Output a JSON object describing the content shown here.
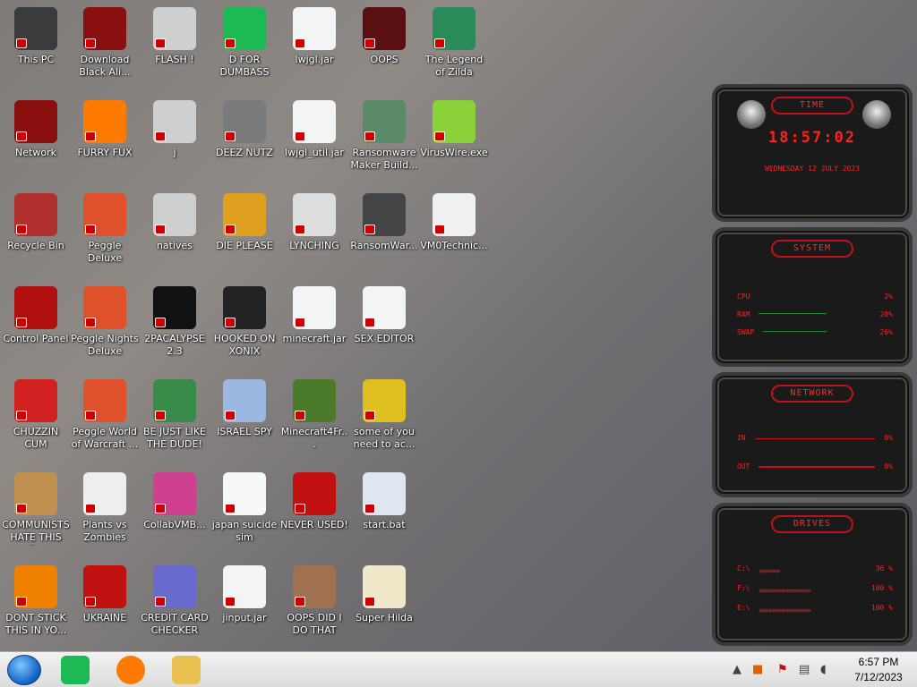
{
  "desktop": {
    "icons": [
      {
        "label": "This PC",
        "icon": "computer-icon",
        "color": "#3b3b3b"
      },
      {
        "label": "Download Black Ali...",
        "icon": "alien-globe-icon",
        "color": "#8a1010"
      },
      {
        "label": "FLASH !",
        "icon": "shortcut-icon",
        "color": "#cfcfcf"
      },
      {
        "label": "D FOR DUMBASS",
        "icon": "spotify-like-icon",
        "color": "#1db954"
      },
      {
        "label": "lwjgl.jar",
        "icon": "java-icon",
        "color": "#f4f4f4"
      },
      {
        "label": "OOPS",
        "icon": "game-cover-icon",
        "color": "#5a1010"
      },
      {
        "label": "The Legend of Zilda",
        "icon": "pixel-character-icon",
        "color": "#2a8a5a"
      },
      {
        "label": "Network",
        "icon": "alien-globe-icon",
        "color": "#8a1010"
      },
      {
        "label": "FURRY FUX",
        "icon": "firefox-icon",
        "color": "#ff7a00"
      },
      {
        "label": "j",
        "icon": "shortcut-icon",
        "color": "#cfcfcf"
      },
      {
        "label": "DEEZ NUTZ",
        "icon": "stacked-windows-icon",
        "color": "#7a7a7a"
      },
      {
        "label": "lwjgl_util.jar",
        "icon": "java-icon",
        "color": "#f4f4f4"
      },
      {
        "label": "Ransomware Maker Build...",
        "icon": "app-window-icon",
        "color": "#5a8a6a"
      },
      {
        "label": "VirusWire.exe",
        "icon": "lime-icon",
        "color": "#8ad13a"
      },
      {
        "label": "Recycle Bin",
        "icon": "recycle-bin-icon",
        "color": "#b03030"
      },
      {
        "label": "Peggle Deluxe",
        "icon": "peggle-icon",
        "color": "#e0502a"
      },
      {
        "label": "natives",
        "icon": "shortcut-icon",
        "color": "#cfcfcf"
      },
      {
        "label": "DIE PLEASE",
        "icon": "de-logo-icon",
        "color": "#e0a020"
      },
      {
        "label": "LYNCHING",
        "icon": "noose-icon",
        "color": "#dddddd"
      },
      {
        "label": "RansomWar...",
        "icon": "skull-icon",
        "color": "#444444"
      },
      {
        "label": "VM0Technic...",
        "icon": "doctor-icon",
        "color": "#f0f0f0"
      },
      {
        "label": "Control Panel",
        "icon": "control-panel-icon",
        "color": "#b01010"
      },
      {
        "label": "Peggle Nights Deluxe",
        "icon": "peggle-icon",
        "color": "#e0502a"
      },
      {
        "label": "2PACALYPSE 2.3",
        "icon": "terminal-icon",
        "color": "#111111"
      },
      {
        "label": "HOOKED ON XONIX",
        "icon": "pixel-game-icon",
        "color": "#222222"
      },
      {
        "label": "minecraft.jar",
        "icon": "java-icon",
        "color": "#f4f4f4"
      },
      {
        "label": "SEX EDITOR",
        "icon": "hxd-icon",
        "color": "#f4f4f4"
      },
      {
        "label": "CHUZZIN CUM",
        "icon": "chuzzle-icon",
        "color": "#d02020"
      },
      {
        "label": "Peggle World of Warcraft ...",
        "icon": "peggle-icon",
        "color": "#e0502a"
      },
      {
        "label": "BE JUST LIKE THE DUDE!",
        "icon": "bowling-icon",
        "color": "#3a8a4a"
      },
      {
        "label": "ISRAEL SPY",
        "icon": "network-computers-icon",
        "color": "#9ab8e0"
      },
      {
        "label": "Minecraft4Fr...",
        "icon": "grass-block-icon",
        "color": "#4a7a2a"
      },
      {
        "label": "some of you need to ac...",
        "icon": "beaver-icon",
        "color": "#e0c020"
      },
      {
        "label": "COMMUNISTS HATE THIS G...",
        "icon": "money-bag-icon",
        "color": "#c09050"
      },
      {
        "label": "Plants vs Zombies",
        "icon": "flower-icon",
        "color": "#eeeeee"
      },
      {
        "label": "CollabVMB...",
        "icon": "monitor-icon",
        "color": "#d04090"
      },
      {
        "label": "japan suicide sim",
        "icon": "pixel-figures-icon",
        "color": "#f8f8f8"
      },
      {
        "label": "NEVER USED!",
        "icon": "devcpp-icon",
        "color": "#c01010"
      },
      {
        "label": "start.bat",
        "icon": "gear-batch-icon",
        "color": "#dfe6ef"
      },
      {
        "label": "DONT STICK THIS IN YO...",
        "icon": "vlc-cone-icon",
        "color": "#f08000"
      },
      {
        "label": "UKRAINE",
        "icon": "radiation-icon",
        "color": "#c01010"
      },
      {
        "label": "CREDIT CARD CHECKER",
        "icon": "credit-card-icon",
        "color": "#6a6acc"
      },
      {
        "label": "jinput.jar",
        "icon": "java-icon",
        "color": "#f4f4f4"
      },
      {
        "label": "OOPS DID I DO THAT",
        "icon": "portrait-icon",
        "color": "#a07050"
      },
      {
        "label": "Super Hilda",
        "icon": "pixel-cat-icon",
        "color": "#f0e8c8"
      }
    ]
  },
  "widgets": {
    "time": {
      "title": "TIME",
      "clock": "18:57:02",
      "date": "WEDNESDAY 12 JULY 2023"
    },
    "system": {
      "title": "SYSTEM",
      "rows": [
        {
          "label": "CPU",
          "value": "2%"
        },
        {
          "label": "RAM",
          "value": "28%"
        },
        {
          "label": "SWAP",
          "value": "26%"
        }
      ]
    },
    "network": {
      "title": "NETWORK",
      "rows": [
        {
          "label": "IN",
          "value": "0%"
        },
        {
          "label": "OUT",
          "value": "0%"
        }
      ]
    },
    "drives": {
      "title": "DRIVES",
      "rows": [
        {
          "label": "C:\\",
          "value": "36 %"
        },
        {
          "label": "F:\\",
          "value": "100 %"
        },
        {
          "label": "E:\\",
          "value": "100 %"
        }
      ]
    },
    "accent": "#ff2020"
  },
  "taskbar": {
    "pinned": [
      {
        "icon": "spotify-like-icon",
        "color": "#1db954"
      },
      {
        "icon": "firefox-icon",
        "color": "#ff7a00"
      },
      {
        "icon": "file-explorer-icon",
        "color": "#e8c050"
      }
    ],
    "tray": [
      "up-arrow-icon",
      "app-tray-icon",
      "flag-alert-icon",
      "network-icon",
      "volume-icon"
    ],
    "clock": {
      "time": "6:57 PM",
      "date": "7/12/2023"
    }
  }
}
